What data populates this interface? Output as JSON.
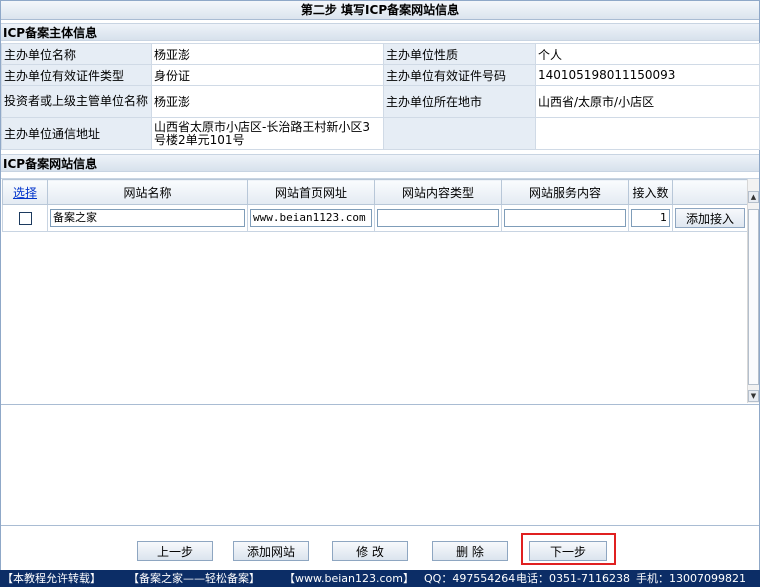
{
  "window": {
    "title": "第二步  填写ICP备案网站信息"
  },
  "subject_section": {
    "heading": "ICP备案主体信息",
    "rows": [
      {
        "label1": "主办单位名称",
        "value1": "杨亚澎",
        "label2": "主办单位性质",
        "value2": "个人"
      },
      {
        "label1": "主办单位有效证件类型",
        "value1": "身份证",
        "label2": "主办单位有效证件号码",
        "value2": "140105198011150093"
      },
      {
        "label1": "投资者或上级主管单位名称",
        "value1": "杨亚澎",
        "label2": "主办单位所在地市",
        "value2": "山西省/太原市/小店区"
      },
      {
        "label1": "主办单位通信地址",
        "value1": "山西省太原市小店区-长治路王村新小区3号楼2单元101号",
        "label2": "",
        "value2": ""
      }
    ]
  },
  "site_section": {
    "heading": "ICP备案网站信息",
    "columns": {
      "select": "选择",
      "name": "网站名称",
      "url": "网站首页网址",
      "content_type": "网站内容类型",
      "service": "网站服务内容",
      "access_count": "接入数"
    },
    "rows": [
      {
        "checked": false,
        "name": "备案之家",
        "url": "www.beian1123.com",
        "content_type": "",
        "service": "",
        "access_count": "1",
        "add_access_label": "添加接入"
      }
    ]
  },
  "buttons": {
    "prev": "上一步",
    "add_site": "添加网站",
    "edit": "修 改",
    "delete": "删 除",
    "next": "下一步"
  },
  "highlight_color": "#e02020",
  "banner": {
    "items": [
      "【本教程允许转载】",
      "【备案之家——轻松备案】",
      "【www.beian123.com】",
      "QQ：497554264",
      "电话：0351-7116238",
      "手机：13007099821"
    ]
  }
}
